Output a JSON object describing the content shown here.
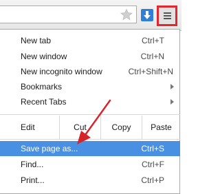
{
  "toolbar": {
    "star_icon": "star-icon",
    "download_icon": "download-arrow-icon",
    "menu_icon": "hamburger-menu-icon",
    "highlight_color": "#e0282e"
  },
  "menu": {
    "new_tab": {
      "label": "New tab",
      "shortcut": "Ctrl+T"
    },
    "new_window": {
      "label": "New window",
      "shortcut": "Ctrl+N"
    },
    "new_incognito": {
      "label": "New incognito window",
      "shortcut": "Ctrl+Shift+N"
    },
    "bookmarks": {
      "label": "Bookmarks"
    },
    "recent_tabs": {
      "label": "Recent Tabs"
    },
    "edit": {
      "label": "Edit",
      "cut": "Cut",
      "copy": "Copy",
      "paste": "Paste"
    },
    "save_page": {
      "label": "Save page as...",
      "shortcut": "Ctrl+S"
    },
    "find": {
      "label": "Find...",
      "shortcut": "Ctrl+F"
    },
    "print": {
      "label": "Print...",
      "shortcut": "Ctrl+P"
    },
    "selected_color": "#4a90e2"
  },
  "annotation": {
    "arrow_color": "#d4252b"
  }
}
